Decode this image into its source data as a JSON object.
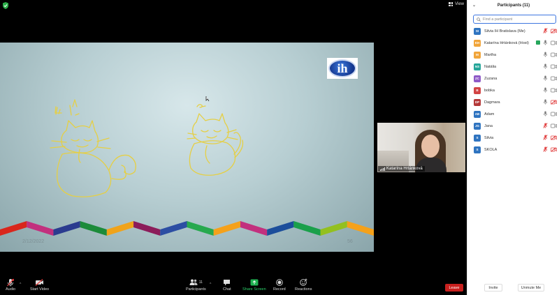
{
  "view_label": "View",
  "slide": {
    "logo_text": "ih",
    "date": "2/12/2022",
    "slide_number": "56",
    "stripe_colors": [
      "#d9261c",
      "#c2307e",
      "#2b3b8f",
      "#1c8b3a",
      "#f0a31a",
      "#8c1c5a",
      "#2c4ea3",
      "#27a94e",
      "#f5a11a",
      "#c2307e",
      "#1c4e9b",
      "#1aa04b",
      "#93c01f",
      "#f5a11a"
    ]
  },
  "video": {
    "participant_name": "Katarína Hrtánková"
  },
  "toolbar": {
    "audio": "Audio",
    "start_video": "Start Video",
    "participants": "Participants",
    "participants_count": "11",
    "chat": "Chat",
    "share_screen": "Share Screen",
    "record": "Record",
    "reactions": "Reactions",
    "leave": "Leave"
  },
  "panel": {
    "title": "Participants (11)",
    "search_placeholder": "Find a participant",
    "invite": "Invite",
    "unmute_me": "Unmute Me",
    "participants": [
      {
        "initials": "SI",
        "name": "Silvia IH Bratislava (Me)",
        "color": "#2f74c0",
        "mic": "muted",
        "cam": "off",
        "host": false
      },
      {
        "initials": "KH",
        "name": "Katarína Hrtánková (Host)",
        "color": "#f1a53a",
        "mic": "on",
        "cam": "on",
        "host": true
      },
      {
        "initials": "M",
        "name": "Martha",
        "color": "#f1a53a",
        "mic": "on",
        "cam": "on",
        "host": false
      },
      {
        "initials": "NS",
        "name": "Natália",
        "color": "#26a69a",
        "mic": "on",
        "cam": "on",
        "host": false
      },
      {
        "initials": "ZC",
        "name": "Zuzana",
        "color": "#8e5ac7",
        "mic": "on",
        "cam": "on",
        "host": false
      },
      {
        "initials": "B",
        "name": "bobka",
        "color": "#d24444",
        "mic": "on",
        "cam": "on",
        "host": false
      },
      {
        "initials": "DP",
        "name": "Dagmara",
        "color": "#b43838",
        "mic": "on",
        "cam": "off",
        "host": false
      },
      {
        "initials": "AB",
        "name": "Adam",
        "color": "#2f74c0",
        "mic": "on",
        "cam": "on",
        "host": false
      },
      {
        "initials": "JG",
        "name": "Jana",
        "color": "#2f74c0",
        "mic": "muted",
        "cam": "on",
        "host": false
      },
      {
        "initials": "S",
        "name": "Silvia",
        "color": "#2f74c0",
        "mic": "muted",
        "cam": "off",
        "host": false
      },
      {
        "initials": "S",
        "name": "SKOLA",
        "color": "#2f74c0",
        "mic": "muted",
        "cam": "off",
        "host": false
      }
    ]
  }
}
